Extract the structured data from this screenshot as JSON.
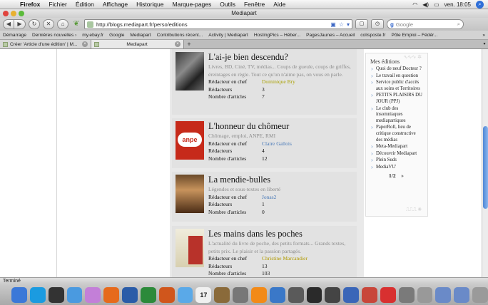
{
  "menubar": {
    "apple": "",
    "items": [
      "Firefox",
      "Fichier",
      "Édition",
      "Affichage",
      "Historique",
      "Marque-pages",
      "Outils",
      "Fenêtre",
      "Aide"
    ],
    "clock": "ven. 18:05",
    "icons": [
      "wifi-icon",
      "volume-icon",
      "battery-icon"
    ]
  },
  "window": {
    "title": "Mediapart"
  },
  "toolbar": {
    "url": "http://blogs.mediapart.fr/perso/editions",
    "search_placeholder": "Google",
    "back_glyph": "◀",
    "forward_glyph": "▶",
    "reload_glyph": "↻",
    "stop_glyph": "✕",
    "home_glyph": "⌂"
  },
  "bookmarks": [
    "Démarrage",
    "Dernières nouvelles ›",
    "my.ebay.fr",
    "Google",
    "Mediapart",
    "Contributions récent...",
    "Activity | Mediapart",
    "HostingPics – Héber...",
    "PagesJaunes – Accueil",
    "colisposte.fr",
    "Pôle Emploi – Fédér..."
  ],
  "tabs": [
    {
      "label": "Créer 'Article d'une édition' | M..."
    },
    {
      "label": "Mediapart"
    }
  ],
  "cards": [
    {
      "title": "L'ai-je bien descendu?",
      "description": "Livres, BD, Ciné, TV, médias... Coups de gueule, coups de griffes, éreintages en règle. Tout ce qu'on n'aime pas, on vous en parle.",
      "chief_label": "Rédacteur en chef",
      "chief": "Dominique Bry",
      "writers_label": "Rédacteurs",
      "writers": "3",
      "articles_label": "Nombre d'articles",
      "articles": "7"
    },
    {
      "title": "L'honneur du chômeur",
      "description": "Chômage, emploi, ANPE, RMI",
      "chief_label": "Rédacteur en chef",
      "chief": "Claire Gallois",
      "writers_label": "Rédacteurs",
      "writers": "4",
      "articles_label": "Nombre d'articles",
      "articles": "12",
      "image_text": "anpe"
    },
    {
      "title": "La mendie-bulles",
      "description": "Légendes et sous-textes en liberté",
      "chief_label": "Rédacteur en chef",
      "chief": "Jonas2",
      "writers_label": "Rédacteurs",
      "writers": "1",
      "articles_label": "Nombre d'articles",
      "articles": "0"
    },
    {
      "title": "Les mains dans les poches",
      "description": "L'actualité du livre de poche, des petits formats... Grands textes, petits prix. Le plaisir et la passion partagés.",
      "chief_label": "Rédacteur en chef",
      "chief": "Christine Marcandier",
      "writers_label": "Rédacteurs",
      "writers": "13",
      "articles_label": "Nombre d'articles",
      "articles": "103"
    }
  ],
  "sidebar": {
    "title": "Mes éditions",
    "items": [
      "Quoi de neuf Docteur ?",
      "Le travail en question",
      "Service public d'accès aux soins et Territoires",
      "PETITS PLAISIRS DU JOUR (PPJ)",
      "Le club des insomniaques mediapartiques",
      "PaperRoll, lieu de critique constructive des médias",
      "Meta-Mediapart",
      "Découvrir Mediapart",
      "Plein Suds",
      "MediaVU'"
    ],
    "pager": "1/2",
    "next": "»"
  },
  "status": {
    "text": "Terminé"
  },
  "dock": {
    "icons": [
      "finder-icon",
      "app-icon",
      "dashboard-icon",
      "safari-icon",
      "ichat-icon",
      "firefox-icon",
      "word-icon",
      "excel-icon",
      "powerpoint-icon",
      "itunes-icon",
      "ical-icon",
      "addressbook-icon",
      "utility-icon",
      "vlc-icon",
      "preview-icon",
      "gallery-icon",
      "video-icon",
      "adium-icon",
      "tv-icon",
      "app-icon-2",
      "mail-icon",
      "lock-icon",
      "camera-icon",
      "documents-folder-icon",
      "applications-folder-icon",
      "trash-icon"
    ],
    "colors": [
      "#3b78d8",
      "#1b9be0",
      "#333",
      "#4a9ae0",
      "#c37fd8",
      "#e66a1c",
      "#2b5ca8",
      "#2c8a3a",
      "#d0561c",
      "#5aa9e8",
      "#f0f0f0",
      "#8a6a3a",
      "#777",
      "#f28a18",
      "#3a78c8",
      "#5a5a5a",
      "#2a2a2a",
      "#444",
      "#3a66b8",
      "#c8463a",
      "#d83030",
      "#7a7a7a",
      "#999",
      "#6a8ac8",
      "#6a8ac8",
      "#9a9a9a"
    ],
    "ical_day": "17"
  }
}
